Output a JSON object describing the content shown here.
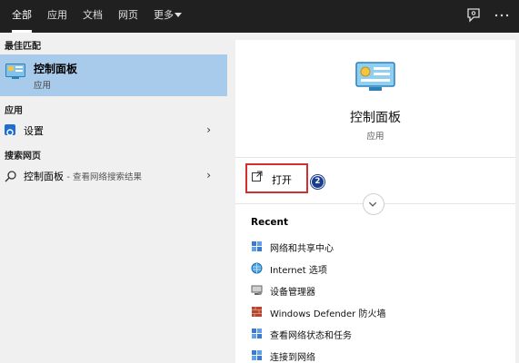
{
  "topbar": {
    "tabs": [
      "全部",
      "应用",
      "文档",
      "网页",
      "更多"
    ],
    "active_tab": "全部",
    "icons": [
      "feedback-icon",
      "more-options-icon"
    ]
  },
  "left": {
    "best_match_heading": "最佳匹配",
    "best_match": {
      "title": "控制面板",
      "subtitle": "应用",
      "icon": "control-panel-icon"
    },
    "apps_heading": "应用",
    "apps": [
      {
        "label": "设置",
        "icon": "settings-gear-icon"
      }
    ],
    "web_heading": "搜索网页",
    "web": [
      {
        "label": "控制面板",
        "hint": "- 查看网络搜索结果",
        "icon": "search-icon"
      }
    ]
  },
  "right": {
    "title": "控制面板",
    "subtitle": "应用",
    "open_label": "打开",
    "badge": "2",
    "recent_heading": "Recent",
    "recent": [
      {
        "label": "网络和共享中心",
        "icon": "network-sharing-icon"
      },
      {
        "label": "Internet 选项",
        "icon": "internet-options-icon"
      },
      {
        "label": "设备管理器",
        "icon": "device-manager-icon"
      },
      {
        "label": "Windows Defender 防火墙",
        "icon": "firewall-icon"
      },
      {
        "label": "查看网络状态和任务",
        "icon": "network-status-icon"
      },
      {
        "label": "连接到网络",
        "icon": "connect-network-icon"
      }
    ]
  },
  "colors": {
    "topbar": "#202020",
    "selected": "#a8cbeb",
    "annotation_red": "#d32f2f",
    "badge": "#1a3c8f"
  }
}
